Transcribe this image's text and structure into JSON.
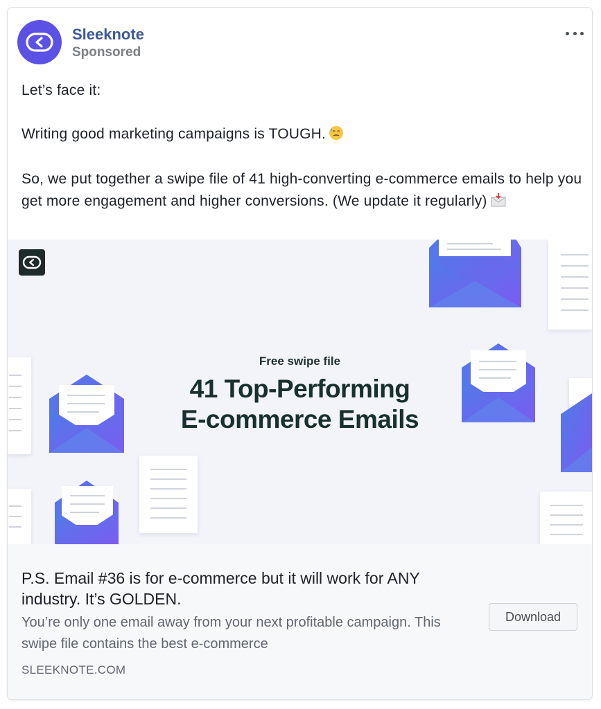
{
  "post": {
    "page_name": "Sleeknote",
    "sponsored_label": "Sponsored",
    "lines": [
      "Let’s face it:",
      "Writing good marketing campaigns is TOUGH.",
      "So, we put together a swipe file of 41 high-converting e-commerce emails to help you get more engagement and higher conversions. (We update it regularly)"
    ],
    "emoji": [
      "sweat-face-emoji",
      "incoming-envelope-emoji"
    ]
  },
  "hero": {
    "kicker": "Free swipe file",
    "title_line1": "41 Top-Performing",
    "title_line2": "E-commerce Emails"
  },
  "link": {
    "headline": "P.S. Email #36 is for e-commerce but it will work for ANY industry. It’s GOLDEN.",
    "description": "You’re only one email away from your next profitable campaign. This swipe file contains the best e-commerce",
    "domain": "SLEEKNOTE.COM",
    "cta_label": "Download"
  },
  "colors": {
    "brand": "#5b52e5",
    "page_name": "#3b5998",
    "envelope_blue": "#4f7be8",
    "envelope_purple": "#7b5cf0"
  },
  "icons": {
    "menu": "more-horizontal-icon",
    "logo": "sleeknote-logo-icon"
  }
}
